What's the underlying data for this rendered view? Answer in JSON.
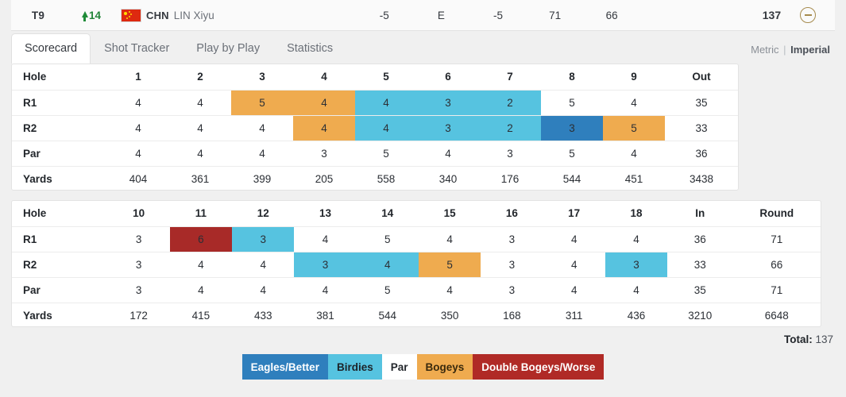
{
  "player_bar": {
    "position": "T9",
    "movement": "14",
    "movement_direction": "up",
    "country_code": "CHN",
    "country_flag": "china-flag-icon",
    "player_name": "LIN Xiyu",
    "to_par_total": "-5",
    "to_par_today": "E",
    "thru_or_score": "-5",
    "round1": "71",
    "round2": "66",
    "blank": "",
    "total": "137",
    "collapse_icon": "circle-minus-icon"
  },
  "tabs": [
    {
      "label": "Scorecard",
      "active": true
    },
    {
      "label": "Shot Tracker",
      "active": false
    },
    {
      "label": "Play by Play",
      "active": false
    },
    {
      "label": "Statistics",
      "active": false
    }
  ],
  "units": {
    "metric": "Metric",
    "separator": "|",
    "imperial": "Imperial",
    "active": "Imperial"
  },
  "front_nine": {
    "header": [
      "Hole",
      "1",
      "2",
      "3",
      "4",
      "5",
      "6",
      "7",
      "8",
      "9",
      "Out"
    ],
    "rows": [
      {
        "label": "R1",
        "values": [
          "4",
          "4",
          "5",
          "4",
          "4",
          "3",
          "2",
          "5",
          "4"
        ],
        "total": "35",
        "styles": [
          "par",
          "par",
          "bogey",
          "bogey",
          "birdie",
          "birdie",
          "birdie",
          "par",
          "par"
        ]
      },
      {
        "label": "R2",
        "values": [
          "4",
          "4",
          "4",
          "4",
          "4",
          "3",
          "2",
          "3",
          "5"
        ],
        "total": "33",
        "styles": [
          "par",
          "par",
          "par",
          "bogey",
          "birdie",
          "birdie",
          "birdie",
          "eagle",
          "bogey"
        ]
      },
      {
        "label": "Par",
        "values": [
          "4",
          "4",
          "4",
          "3",
          "5",
          "4",
          "3",
          "5",
          "4"
        ],
        "total": "36",
        "styles": [
          "par",
          "par",
          "par",
          "par",
          "par",
          "par",
          "par",
          "par",
          "par"
        ]
      },
      {
        "label": "Yards",
        "values": [
          "404",
          "361",
          "399",
          "205",
          "558",
          "340",
          "176",
          "544",
          "451"
        ],
        "total": "3438",
        "styles": [
          "par",
          "par",
          "par",
          "par",
          "par",
          "par",
          "par",
          "par",
          "par"
        ]
      }
    ]
  },
  "back_nine": {
    "header": [
      "Hole",
      "10",
      "11",
      "12",
      "13",
      "14",
      "15",
      "16",
      "17",
      "18",
      "In",
      "Round"
    ],
    "rows": [
      {
        "label": "R1",
        "values": [
          "3",
          "6",
          "3",
          "4",
          "5",
          "4",
          "3",
          "4",
          "4"
        ],
        "total": "36",
        "round": "71",
        "styles": [
          "par",
          "double",
          "birdie",
          "par",
          "par",
          "par",
          "par",
          "par",
          "par"
        ]
      },
      {
        "label": "R2",
        "values": [
          "3",
          "4",
          "4",
          "3",
          "4",
          "5",
          "3",
          "4",
          "3"
        ],
        "total": "33",
        "round": "66",
        "styles": [
          "par",
          "par",
          "par",
          "birdie",
          "birdie",
          "bogey",
          "par",
          "par",
          "birdie"
        ]
      },
      {
        "label": "Par",
        "values": [
          "3",
          "4",
          "4",
          "4",
          "5",
          "4",
          "3",
          "4",
          "4"
        ],
        "total": "35",
        "round": "71",
        "styles": [
          "par",
          "par",
          "par",
          "par",
          "par",
          "par",
          "par",
          "par",
          "par"
        ]
      },
      {
        "label": "Yards",
        "values": [
          "172",
          "415",
          "433",
          "381",
          "544",
          "350",
          "168",
          "311",
          "436"
        ],
        "total": "3210",
        "round": "6648",
        "styles": [
          "par",
          "par",
          "par",
          "par",
          "par",
          "par",
          "par",
          "par",
          "par"
        ]
      }
    ]
  },
  "total_line": {
    "label": "Total:",
    "value": "137"
  },
  "legend": [
    {
      "label": "Eagles/Better",
      "key": "eagle",
      "color": "#2f7fbd"
    },
    {
      "label": "Birdies",
      "key": "birdie",
      "color": "#56c3e0"
    },
    {
      "label": "Par",
      "key": "par",
      "color": "#ffffff"
    },
    {
      "label": "Bogeys",
      "key": "bogey",
      "color": "#efab4f"
    },
    {
      "label": "Double Bogeys/Worse",
      "key": "double",
      "color": "#b02a26"
    }
  ]
}
